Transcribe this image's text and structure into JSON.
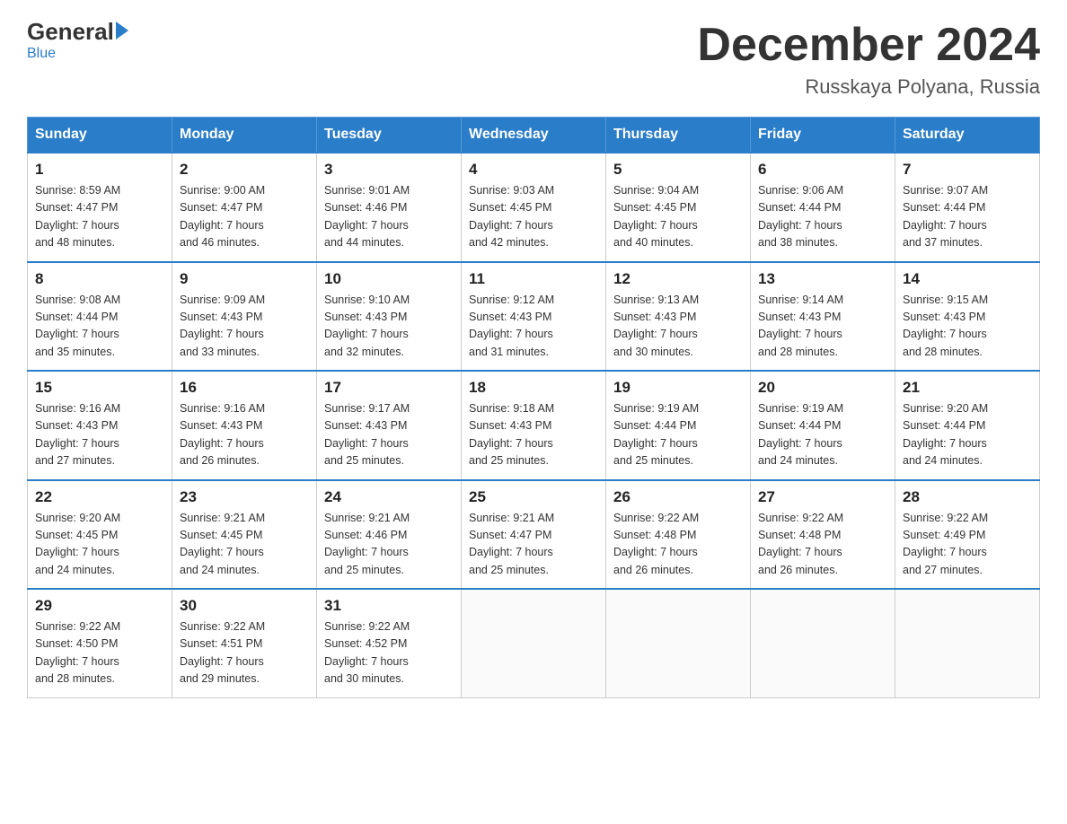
{
  "header": {
    "logo_general": "General",
    "logo_blue": "Blue",
    "month_title": "December 2024",
    "subtitle": "Russkaya Polyana, Russia"
  },
  "weekdays": [
    "Sunday",
    "Monday",
    "Tuesday",
    "Wednesday",
    "Thursday",
    "Friday",
    "Saturday"
  ],
  "weeks": [
    [
      {
        "day": "1",
        "sunrise": "8:59 AM",
        "sunset": "4:47 PM",
        "daylight": "7 hours and 48 minutes."
      },
      {
        "day": "2",
        "sunrise": "9:00 AM",
        "sunset": "4:47 PM",
        "daylight": "7 hours and 46 minutes."
      },
      {
        "day": "3",
        "sunrise": "9:01 AM",
        "sunset": "4:46 PM",
        "daylight": "7 hours and 44 minutes."
      },
      {
        "day": "4",
        "sunrise": "9:03 AM",
        "sunset": "4:45 PM",
        "daylight": "7 hours and 42 minutes."
      },
      {
        "day": "5",
        "sunrise": "9:04 AM",
        "sunset": "4:45 PM",
        "daylight": "7 hours and 40 minutes."
      },
      {
        "day": "6",
        "sunrise": "9:06 AM",
        "sunset": "4:44 PM",
        "daylight": "7 hours and 38 minutes."
      },
      {
        "day": "7",
        "sunrise": "9:07 AM",
        "sunset": "4:44 PM",
        "daylight": "7 hours and 37 minutes."
      }
    ],
    [
      {
        "day": "8",
        "sunrise": "9:08 AM",
        "sunset": "4:44 PM",
        "daylight": "7 hours and 35 minutes."
      },
      {
        "day": "9",
        "sunrise": "9:09 AM",
        "sunset": "4:43 PM",
        "daylight": "7 hours and 33 minutes."
      },
      {
        "day": "10",
        "sunrise": "9:10 AM",
        "sunset": "4:43 PM",
        "daylight": "7 hours and 32 minutes."
      },
      {
        "day": "11",
        "sunrise": "9:12 AM",
        "sunset": "4:43 PM",
        "daylight": "7 hours and 31 minutes."
      },
      {
        "day": "12",
        "sunrise": "9:13 AM",
        "sunset": "4:43 PM",
        "daylight": "7 hours and 30 minutes."
      },
      {
        "day": "13",
        "sunrise": "9:14 AM",
        "sunset": "4:43 PM",
        "daylight": "7 hours and 28 minutes."
      },
      {
        "day": "14",
        "sunrise": "9:15 AM",
        "sunset": "4:43 PM",
        "daylight": "7 hours and 28 minutes."
      }
    ],
    [
      {
        "day": "15",
        "sunrise": "9:16 AM",
        "sunset": "4:43 PM",
        "daylight": "7 hours and 27 minutes."
      },
      {
        "day": "16",
        "sunrise": "9:16 AM",
        "sunset": "4:43 PM",
        "daylight": "7 hours and 26 minutes."
      },
      {
        "day": "17",
        "sunrise": "9:17 AM",
        "sunset": "4:43 PM",
        "daylight": "7 hours and 25 minutes."
      },
      {
        "day": "18",
        "sunrise": "9:18 AM",
        "sunset": "4:43 PM",
        "daylight": "7 hours and 25 minutes."
      },
      {
        "day": "19",
        "sunrise": "9:19 AM",
        "sunset": "4:44 PM",
        "daylight": "7 hours and 25 minutes."
      },
      {
        "day": "20",
        "sunrise": "9:19 AM",
        "sunset": "4:44 PM",
        "daylight": "7 hours and 24 minutes."
      },
      {
        "day": "21",
        "sunrise": "9:20 AM",
        "sunset": "4:44 PM",
        "daylight": "7 hours and 24 minutes."
      }
    ],
    [
      {
        "day": "22",
        "sunrise": "9:20 AM",
        "sunset": "4:45 PM",
        "daylight": "7 hours and 24 minutes."
      },
      {
        "day": "23",
        "sunrise": "9:21 AM",
        "sunset": "4:45 PM",
        "daylight": "7 hours and 24 minutes."
      },
      {
        "day": "24",
        "sunrise": "9:21 AM",
        "sunset": "4:46 PM",
        "daylight": "7 hours and 25 minutes."
      },
      {
        "day": "25",
        "sunrise": "9:21 AM",
        "sunset": "4:47 PM",
        "daylight": "7 hours and 25 minutes."
      },
      {
        "day": "26",
        "sunrise": "9:22 AM",
        "sunset": "4:48 PM",
        "daylight": "7 hours and 26 minutes."
      },
      {
        "day": "27",
        "sunrise": "9:22 AM",
        "sunset": "4:48 PM",
        "daylight": "7 hours and 26 minutes."
      },
      {
        "day": "28",
        "sunrise": "9:22 AM",
        "sunset": "4:49 PM",
        "daylight": "7 hours and 27 minutes."
      }
    ],
    [
      {
        "day": "29",
        "sunrise": "9:22 AM",
        "sunset": "4:50 PM",
        "daylight": "7 hours and 28 minutes."
      },
      {
        "day": "30",
        "sunrise": "9:22 AM",
        "sunset": "4:51 PM",
        "daylight": "7 hours and 29 minutes."
      },
      {
        "day": "31",
        "sunrise": "9:22 AM",
        "sunset": "4:52 PM",
        "daylight": "7 hours and 30 minutes."
      },
      null,
      null,
      null,
      null
    ]
  ],
  "labels": {
    "sunrise": "Sunrise:",
    "sunset": "Sunset:",
    "daylight": "Daylight:"
  }
}
